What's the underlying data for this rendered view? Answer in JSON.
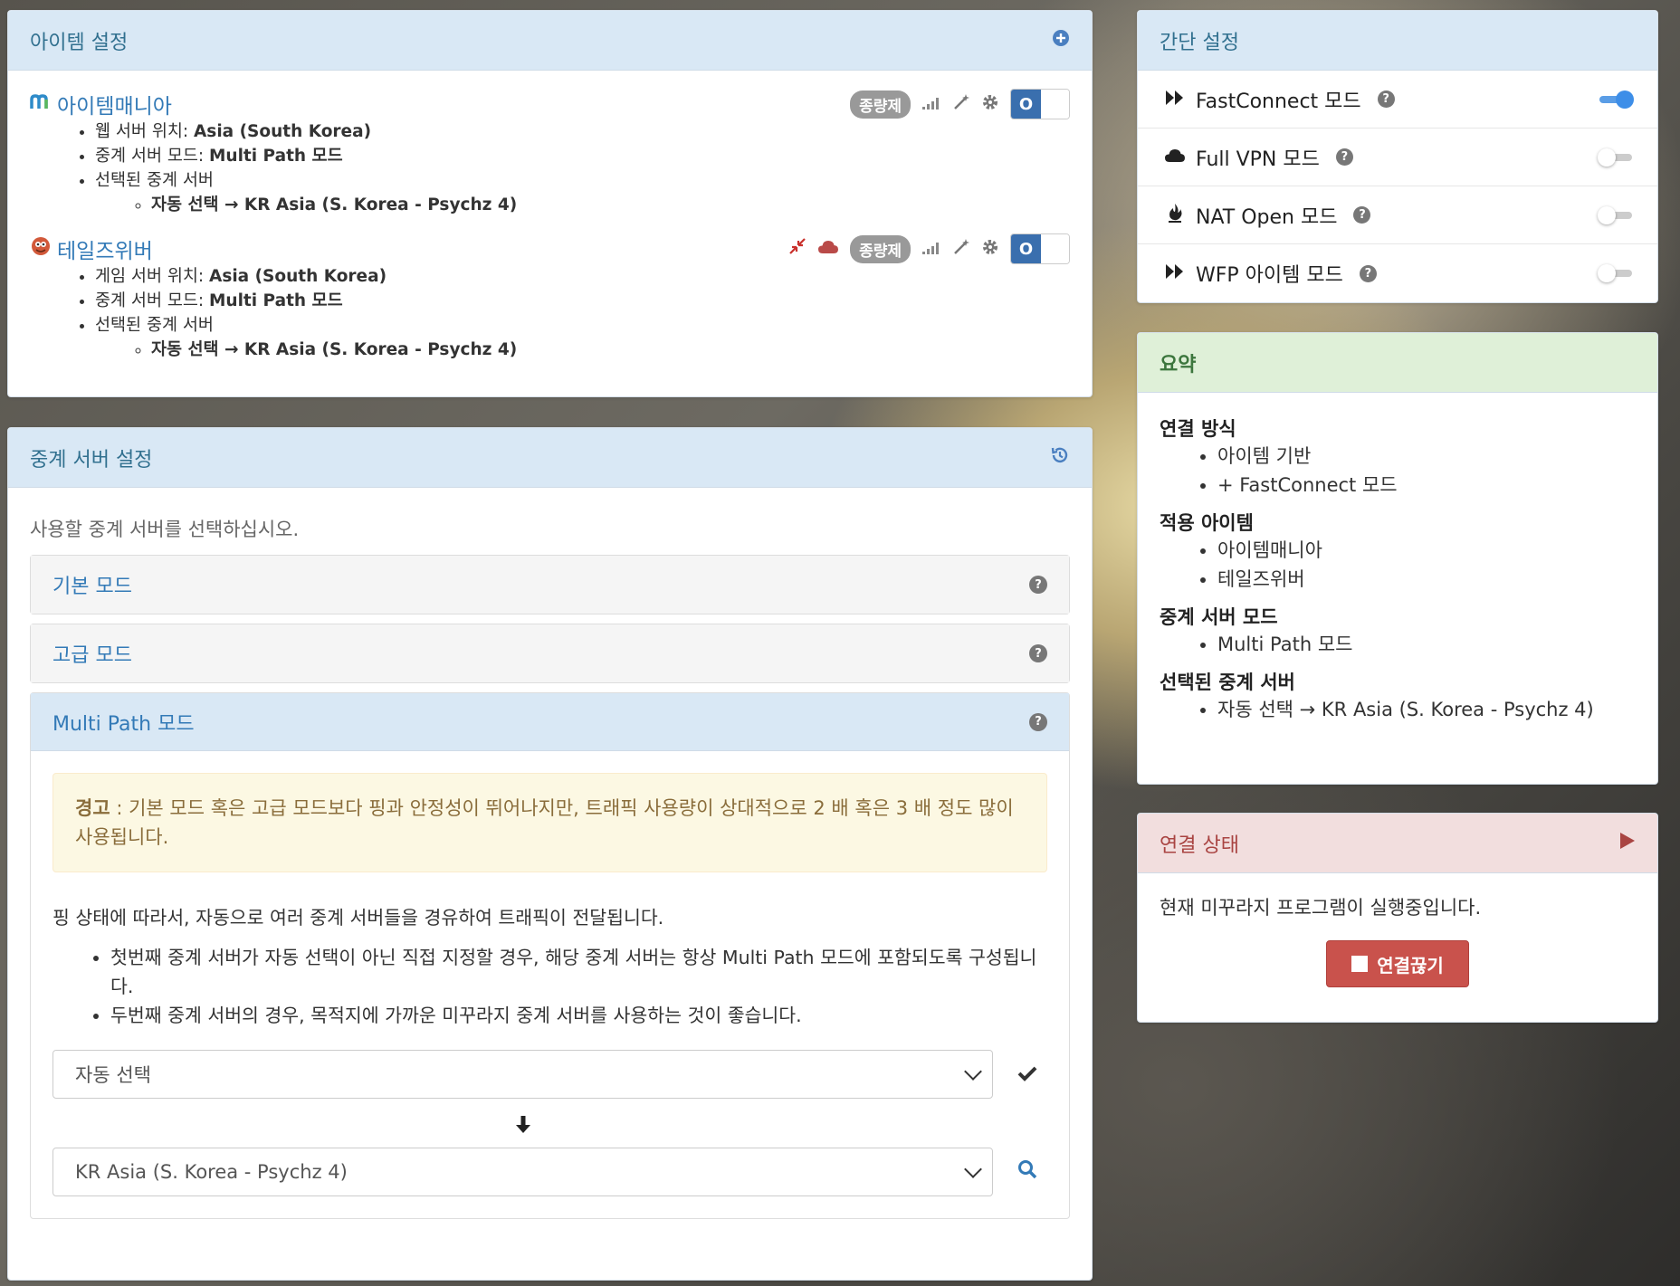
{
  "item_settings": {
    "title": "아이템 설정",
    "items": [
      {
        "name": "아이템매니아",
        "badge": "종량제",
        "toggle_label": "O",
        "details": [
          {
            "label": "웹 서버 위치: ",
            "value": "Asia (South Korea)"
          },
          {
            "label": "중계 서버 모드: ",
            "value": "Multi Path 모드"
          },
          {
            "label": "선택된 중계 서버",
            "value": ""
          }
        ],
        "relay": "자동 선택 → KR Asia (S. Korea - Psychz 4)"
      },
      {
        "name": "테일즈위버",
        "badge": "종량제",
        "toggle_label": "O",
        "details": [
          {
            "label": "게임 서버 위치: ",
            "value": "Asia (South Korea)"
          },
          {
            "label": "중계 서버 모드: ",
            "value": "Multi Path 모드"
          },
          {
            "label": "선택된 중계 서버",
            "value": ""
          }
        ],
        "relay": "자동 선택 → KR Asia (S. Korea - Psychz 4)"
      }
    ]
  },
  "relay_settings": {
    "title": "중계 서버 설정",
    "intro": "사용할 중계 서버를 선택하십시오.",
    "modes": [
      "기본 모드",
      "고급 모드",
      "Multi Path 모드"
    ],
    "warning_label": "경고",
    "warning_text": " : 기본 모드 혹은 고급 모드보다 핑과 안정성이 뛰어나지만, 트래픽 사용량이 상대적으로 2 배 혹은 3 배 정도 많이 사용됩니다.",
    "description": "핑 상태에 따라서, 자동으로 여러 중계 서버들을 경유하여 트래픽이 전달됩니다.",
    "bullets": [
      "첫번째 중계 서버가 자동 선택이 아닌 직접 지정할 경우, 해당 중계 서버는 항상 Multi Path 모드에 포함되도록 구성됩니다.",
      "두번째 중계 서버의 경우, 목적지에 가까운 미꾸라지 중계 서버를 사용하는 것이 좋습니다."
    ],
    "first_select": "자동 선택",
    "second_select": "KR Asia (S. Korea - Psychz 4)"
  },
  "quick_settings": {
    "title": "간단 설정",
    "rows": [
      {
        "label": "FastConnect 모드",
        "on": true
      },
      {
        "label": "Full VPN 모드",
        "on": false
      },
      {
        "label": "NAT Open 모드",
        "on": false
      },
      {
        "label": "WFP 아이템 모드",
        "on": false
      }
    ]
  },
  "summary": {
    "title": "요약",
    "sections": [
      {
        "heading": "연결 방식",
        "items": [
          "아이템 기반",
          "+ FastConnect 모드"
        ]
      },
      {
        "heading": "적용 아이템",
        "items": [
          "아이템매니아",
          "테일즈위버"
        ]
      },
      {
        "heading": "중계 서버 모드",
        "items": [
          "Multi Path 모드"
        ]
      },
      {
        "heading": "선택된 중계 서버",
        "items": [
          "자동 선택 → KR Asia (S. Korea - Psychz 4)"
        ]
      }
    ]
  },
  "connection_status": {
    "title": "연결 상태",
    "status_text": "현재 미꾸라지 프로그램이 실행중입니다.",
    "disconnect_label": "연결끊기"
  },
  "colors": {
    "primary": "#337ab7",
    "danger": "#c9524c",
    "warning_bg": "#fcf8e3",
    "toggle_on": "#3a6fae"
  }
}
